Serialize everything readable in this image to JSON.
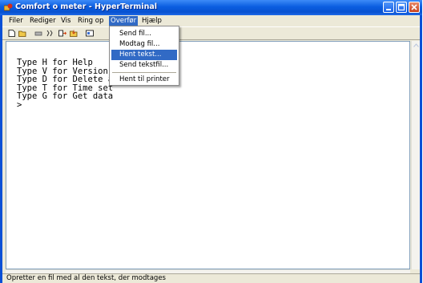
{
  "window": {
    "title": "Comfort o meter - HyperTerminal"
  },
  "colors": {
    "titlebar": "#0a5de0",
    "menu_highlight": "#316ac5",
    "window_bg": "#ece9d8"
  },
  "menubar": {
    "items": [
      {
        "label": "Filer"
      },
      {
        "label": "Rediger"
      },
      {
        "label": "Vis"
      },
      {
        "label": "Ring op"
      },
      {
        "label": "Overfør"
      },
      {
        "label": "Hjælp"
      }
    ],
    "active": "Overfør"
  },
  "toolbar": {
    "icons": [
      "new-icon",
      "open-icon",
      "connect-icon",
      "disconnect-icon",
      "send-icon",
      "receive-icon",
      "properties-icon"
    ]
  },
  "dropdown": {
    "items": [
      {
        "label": "Send fil..."
      },
      {
        "label": "Modtag fil..."
      },
      {
        "label": "Hent tekst..."
      },
      {
        "label": "Send tekstfil..."
      },
      {
        "label": "Hent til printer"
      }
    ],
    "highlighted": "Hent tekst..."
  },
  "terminal": {
    "lines": [
      "Type H for Help",
      "Type V for Version",
      "Type D for Delete a",
      "Type T for Time set",
      "Type G for Get data",
      ">"
    ]
  },
  "statusbar": {
    "text": "Opretter en fil med al den tekst, der modtages"
  }
}
